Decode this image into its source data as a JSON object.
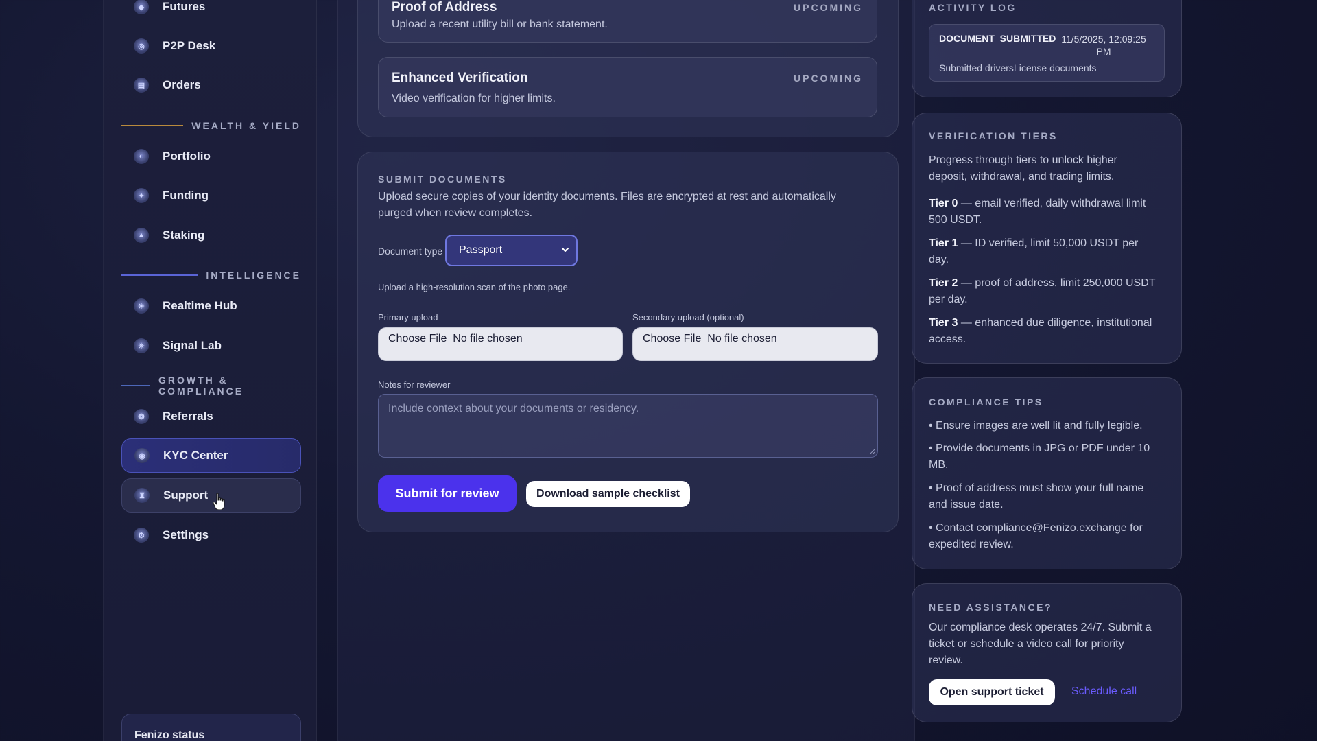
{
  "sidebar": {
    "items_top": [
      {
        "label": "Futures",
        "icon": "futures-icon"
      },
      {
        "label": "P2P Desk",
        "icon": "p2p-icon"
      },
      {
        "label": "Orders",
        "icon": "orders-icon"
      }
    ],
    "sections": [
      {
        "label": "WEALTH & YIELD",
        "color": "#b98a3c"
      },
      {
        "label": "INTELLIGENCE",
        "color": "#5a64d6"
      },
      {
        "label": "GROWTH & COMPLIANCE",
        "color": "#4d67b8"
      }
    ],
    "wealth_items": [
      {
        "label": "Portfolio",
        "icon": "portfolio-icon"
      },
      {
        "label": "Funding",
        "icon": "funding-icon"
      },
      {
        "label": "Staking",
        "icon": "staking-icon"
      }
    ],
    "intel_items": [
      {
        "label": "Realtime Hub",
        "icon": "realtime-hub-icon"
      },
      {
        "label": "Signal Lab",
        "icon": "signal-lab-icon"
      }
    ],
    "growth_items": [
      {
        "label": "Referrals",
        "icon": "referrals-icon"
      },
      {
        "label": "KYC Center",
        "icon": "kyc-icon"
      },
      {
        "label": "Support",
        "icon": "support-icon"
      },
      {
        "label": "Settings",
        "icon": "settings-icon"
      }
    ],
    "status_label": "Fenizo status"
  },
  "verification_steps": [
    {
      "title": "Proof of Address",
      "desc": "Upload a recent utility bill or bank statement.",
      "status": "UPCOMING"
    },
    {
      "title": "Enhanced Verification",
      "desc": "Video verification for higher limits.",
      "status": "UPCOMING"
    }
  ],
  "submit": {
    "heading": "SUBMIT DOCUMENTS",
    "intro_line1": "Upload secure copies of your identity documents. Files are encrypted at rest and automatically",
    "intro_line2": "purged when review completes.",
    "doc_type_label": "Document type",
    "doc_type_value": "Passport",
    "hint": "Upload a high-resolution scan of the photo page.",
    "primary_label": "Primary upload",
    "secondary_label": "Secondary upload (optional)",
    "file_text": "Choose File  No file chosen",
    "notes_label": "Notes for reviewer",
    "notes_placeholder": "Include context about your documents or residency.",
    "submit_button": "Submit for review",
    "checklist_button": "Download sample checklist"
  },
  "activity": {
    "heading": "ACTIVITY LOG",
    "event": "DOCUMENT_SUBMITTED",
    "time_line1": "11/5/2025, 12:09:25",
    "time_line2": "PM",
    "detail": "Submitted driversLicense documents"
  },
  "tiers": {
    "heading": "VERIFICATION TIERS",
    "intro_line1": "Progress through tiers to unlock higher",
    "intro_line2": "deposit, withdrawal, and trading limits.",
    "items": [
      {
        "name": "Tier 0",
        "line1": " — email verified, daily withdrawal limit",
        "line2": "500 USDT."
      },
      {
        "name": "Tier 1",
        "line1": " — ID verified, limit 50,000 USDT per",
        "line2": "day."
      },
      {
        "name": "Tier 2",
        "line1": " — proof of address, limit 250,000 USDT",
        "line2": "per day."
      },
      {
        "name": "Tier 3",
        "line1": " — enhanced due diligence, institutional",
        "line2": "access."
      }
    ]
  },
  "tips": {
    "heading": "COMPLIANCE TIPS",
    "items": [
      {
        "line1": "• Ensure images are well lit and fully legible.",
        "line2": ""
      },
      {
        "line1": "• Provide documents in JPG or PDF under 10",
        "line2": "MB."
      },
      {
        "line1": "• Proof of address must show your full name",
        "line2": "and issue date."
      },
      {
        "line1": "• Contact compliance@Fenizo.exchange for",
        "line2": "expedited review."
      }
    ]
  },
  "assist": {
    "heading": "NEED ASSISTANCE?",
    "line1": "Our compliance desk operates 24/7. Submit a",
    "line2": "ticket or schedule a video call for priority",
    "line3": "review.",
    "ticket_button": "Open support ticket",
    "schedule_link": "Schedule call"
  },
  "colors": {
    "accent": "#4b32ec",
    "link": "#6b5cff"
  }
}
